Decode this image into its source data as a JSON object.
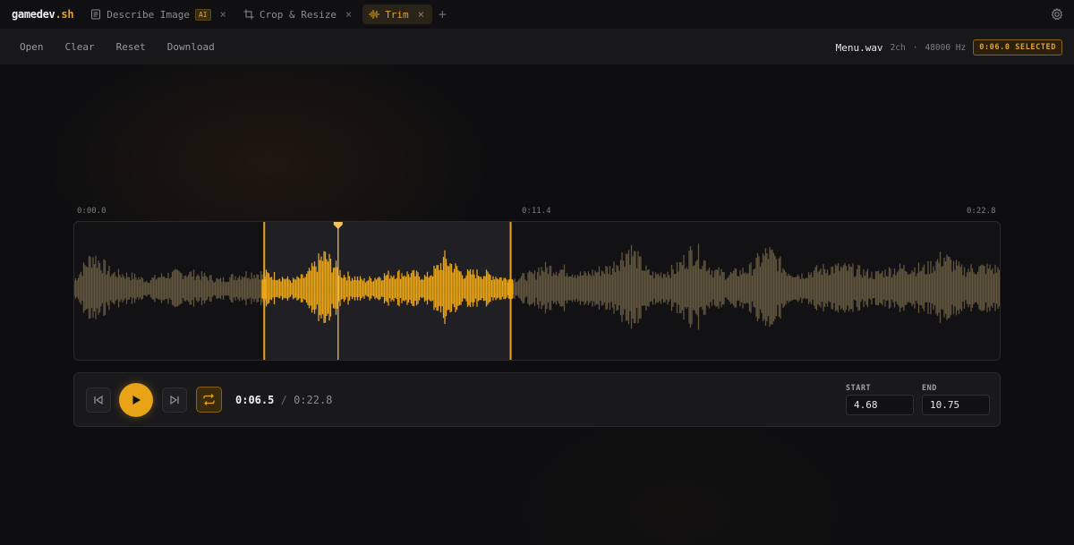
{
  "app": {
    "brand_prefix": "gamedev",
    "brand_suffix": ".sh"
  },
  "tabs": [
    {
      "label": "Describe Image",
      "badge": "AI",
      "icon": "document-icon",
      "active": false
    },
    {
      "label": "Crop & Resize",
      "icon": "crop-icon",
      "active": false
    },
    {
      "label": "Trim",
      "icon": "waveform-icon",
      "active": true
    }
  ],
  "toolbar": {
    "open_label": "Open",
    "clear_label": "Clear",
    "reset_label": "Reset",
    "download_label": "Download"
  },
  "file": {
    "name": "Menu.wav",
    "channels": "2ch",
    "separator": "·",
    "sample_rate": "48000 Hz",
    "selected_badge": "0:06.0 SELECTED"
  },
  "timeline": {
    "start_tick": "0:00.0",
    "mid_tick": "0:11.4",
    "end_tick": "0:22.8",
    "duration_seconds": 22.8,
    "selection_start_seconds": 4.68,
    "selection_end_seconds": 10.75,
    "playhead_seconds": 6.5
  },
  "transport": {
    "current_time": "0:06.5",
    "divider": "/",
    "total_time": "0:22.8",
    "start_label": "START",
    "start_value": "4.68",
    "end_label": "END",
    "end_value": "10.75"
  },
  "colors": {
    "accent": "#e8a317",
    "waveform_dim": "#6e5f44",
    "background": "#0e0e10"
  }
}
